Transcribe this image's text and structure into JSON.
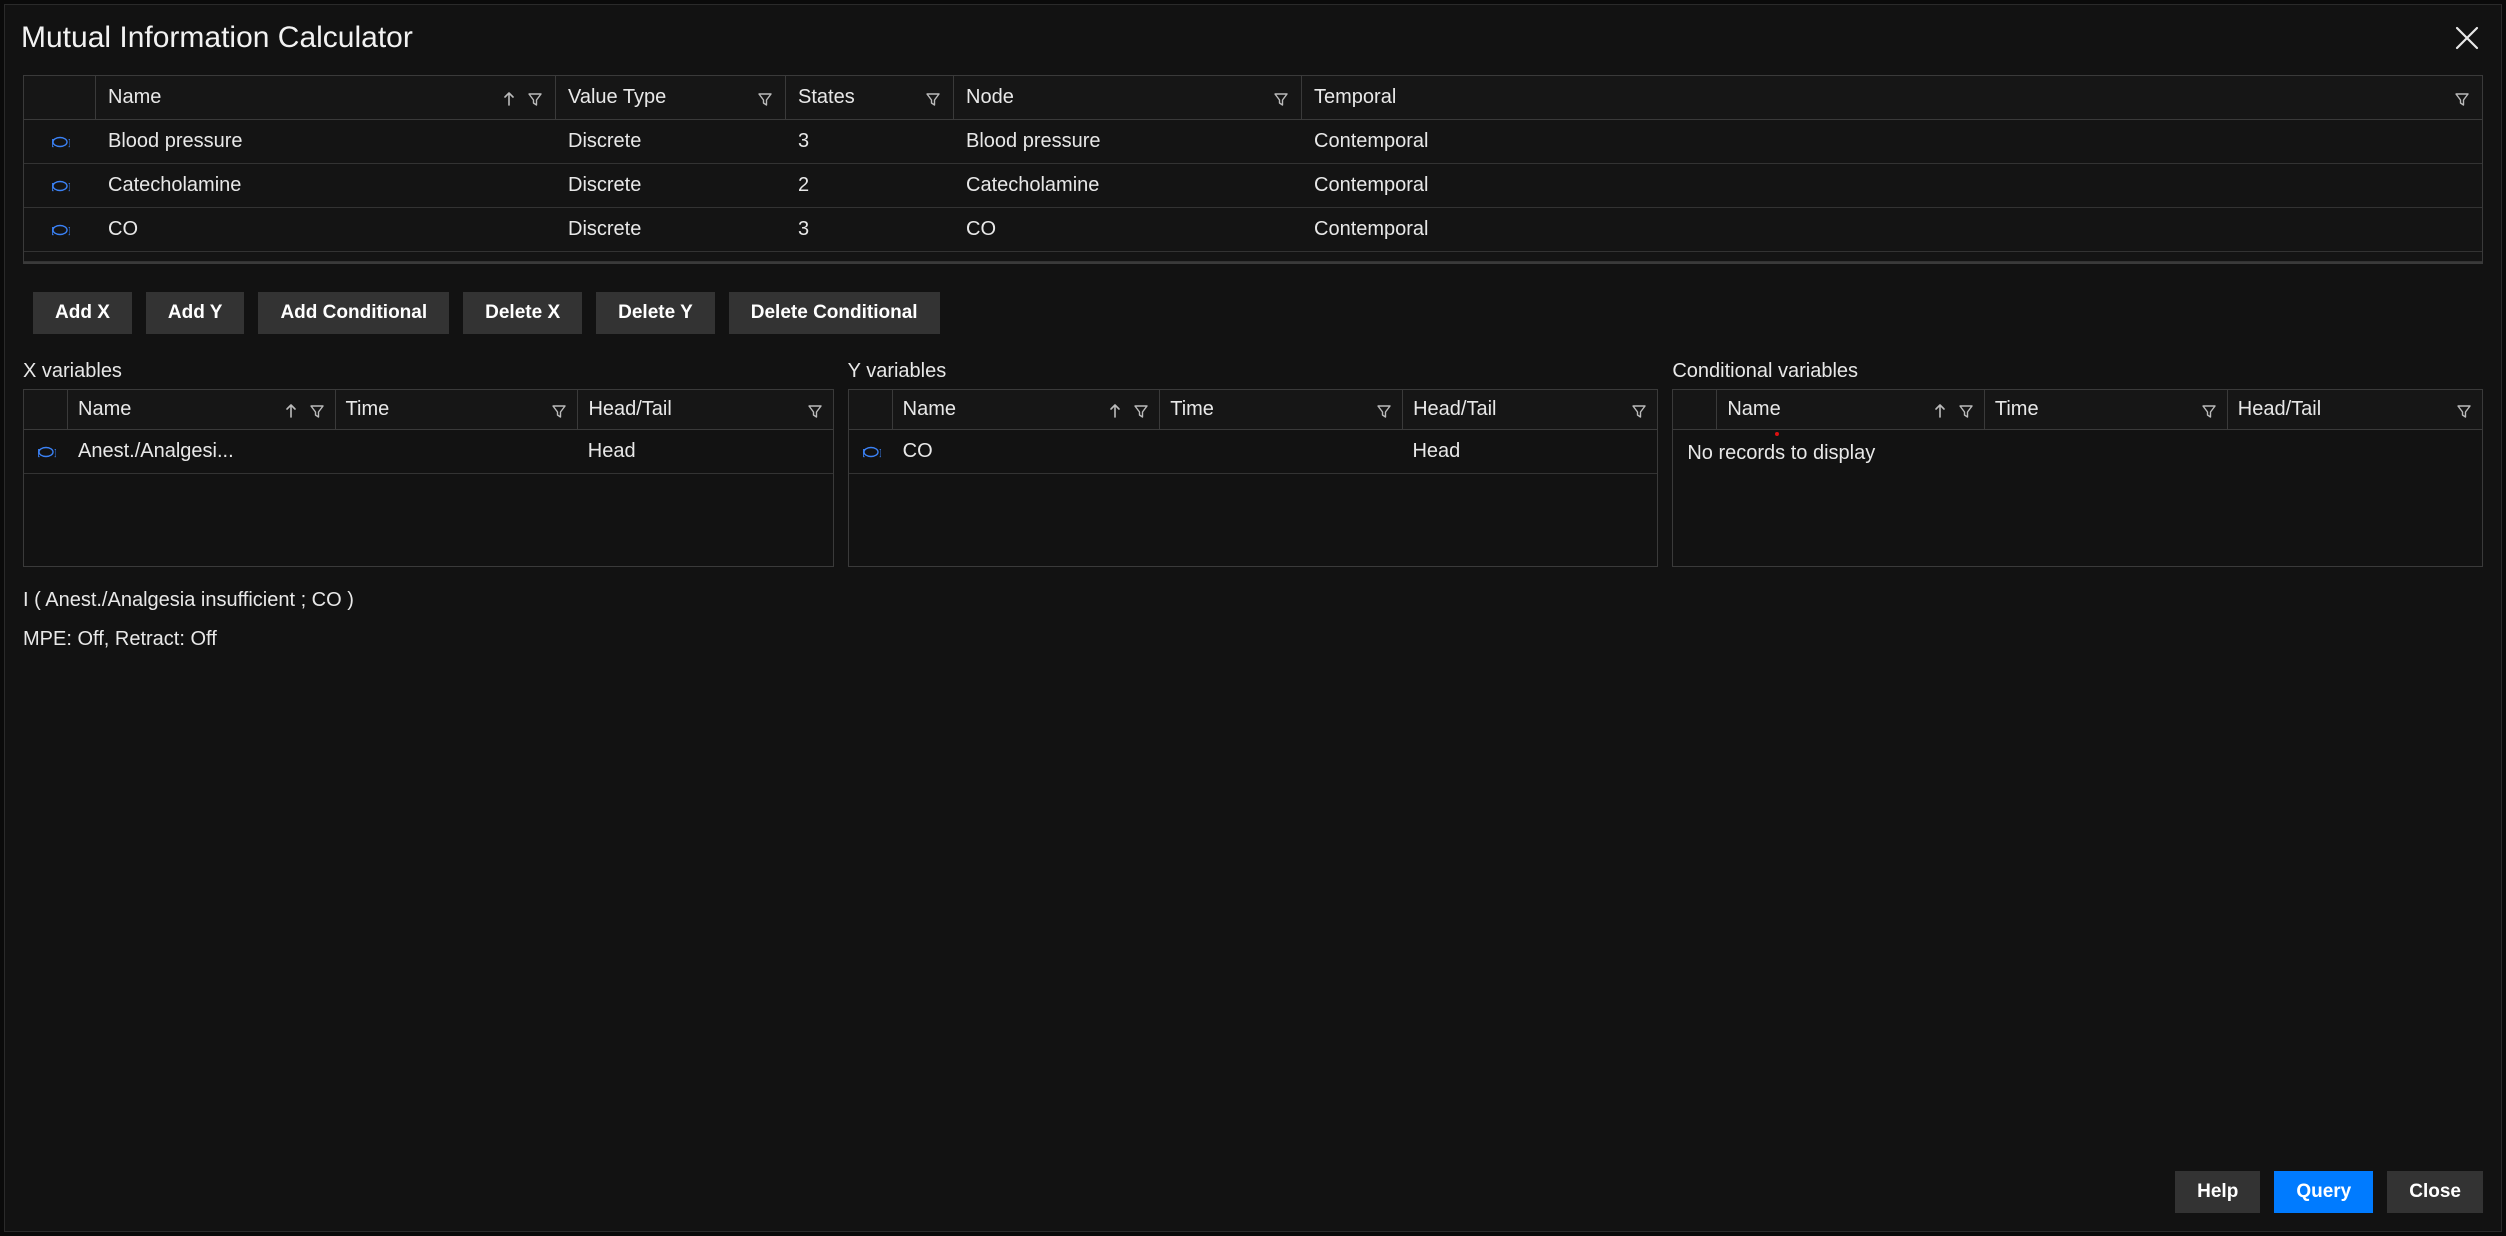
{
  "dialog": {
    "title": "Mutual Information Calculator"
  },
  "main_table": {
    "columns": {
      "name": "Name",
      "value_type": "Value Type",
      "states": "States",
      "node": "Node",
      "temporal": "Temporal"
    },
    "rows": [
      {
        "name": "Blood pressure",
        "value_type": "Discrete",
        "states": "3",
        "node": "Blood pressure",
        "temporal": "Contemporal"
      },
      {
        "name": "Catecholamine",
        "value_type": "Discrete",
        "states": "2",
        "node": "Catecholamine",
        "temporal": "Contemporal"
      },
      {
        "name": "CO",
        "value_type": "Discrete",
        "states": "3",
        "node": "CO",
        "temporal": "Contemporal"
      }
    ]
  },
  "buttons": {
    "add_x": "Add X",
    "add_y": "Add Y",
    "add_cond": "Add Conditional",
    "del_x": "Delete X",
    "del_y": "Delete Y",
    "del_cond": "Delete Conditional"
  },
  "small_columns": {
    "name": "Name",
    "time": "Time",
    "head_tail": "Head/Tail"
  },
  "x_section": {
    "label": "X variables",
    "rows": [
      {
        "name": "Anest./Analgesi...",
        "time": "",
        "head_tail": "Head"
      }
    ]
  },
  "y_section": {
    "label": "Y variables",
    "rows": [
      {
        "name": "CO",
        "time": "",
        "head_tail": "Head"
      }
    ]
  },
  "cond_section": {
    "label": "Conditional variables",
    "empty_text": "No records to display"
  },
  "formula": "I ( Anest./Analgesia insufficient ; CO )",
  "status": "MPE: Off, Retract: Off",
  "footer_buttons": {
    "help": "Help",
    "query": "Query",
    "close": "Close"
  }
}
